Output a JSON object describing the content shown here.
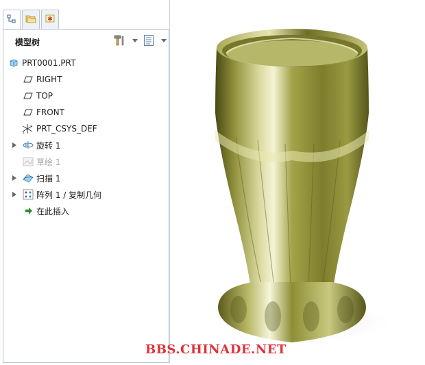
{
  "tabs": [
    {
      "icon": "model-tree-icon",
      "active": true
    },
    {
      "icon": "folder-browser-icon",
      "active": false
    },
    {
      "icon": "favorites-icon",
      "active": false
    }
  ],
  "tree": {
    "title": "模型树",
    "root": "PRT0001.PRT",
    "items": [
      {
        "label": "RIGHT",
        "icon": "datum-plane-icon"
      },
      {
        "label": "TOP",
        "icon": "datum-plane-icon"
      },
      {
        "label": "FRONT",
        "icon": "datum-plane-icon"
      },
      {
        "label": "PRT_CSYS_DEF",
        "icon": "coordinate-system-icon"
      },
      {
        "label": "旋转 1",
        "icon": "revolve-icon"
      },
      {
        "label": "草绘 1",
        "icon": "sketch-icon"
      },
      {
        "label": "扫描 1",
        "icon": "sweep-icon"
      },
      {
        "label": "阵列 1 / 复制几何",
        "icon": "pattern-icon"
      },
      {
        "label": "在此插入",
        "icon": "insert-here-arrow-icon"
      }
    ]
  },
  "viewport": {
    "object": "vase-model-3d",
    "color": "#8f8f3a"
  },
  "watermark": "BBS.CHINADE.NET"
}
